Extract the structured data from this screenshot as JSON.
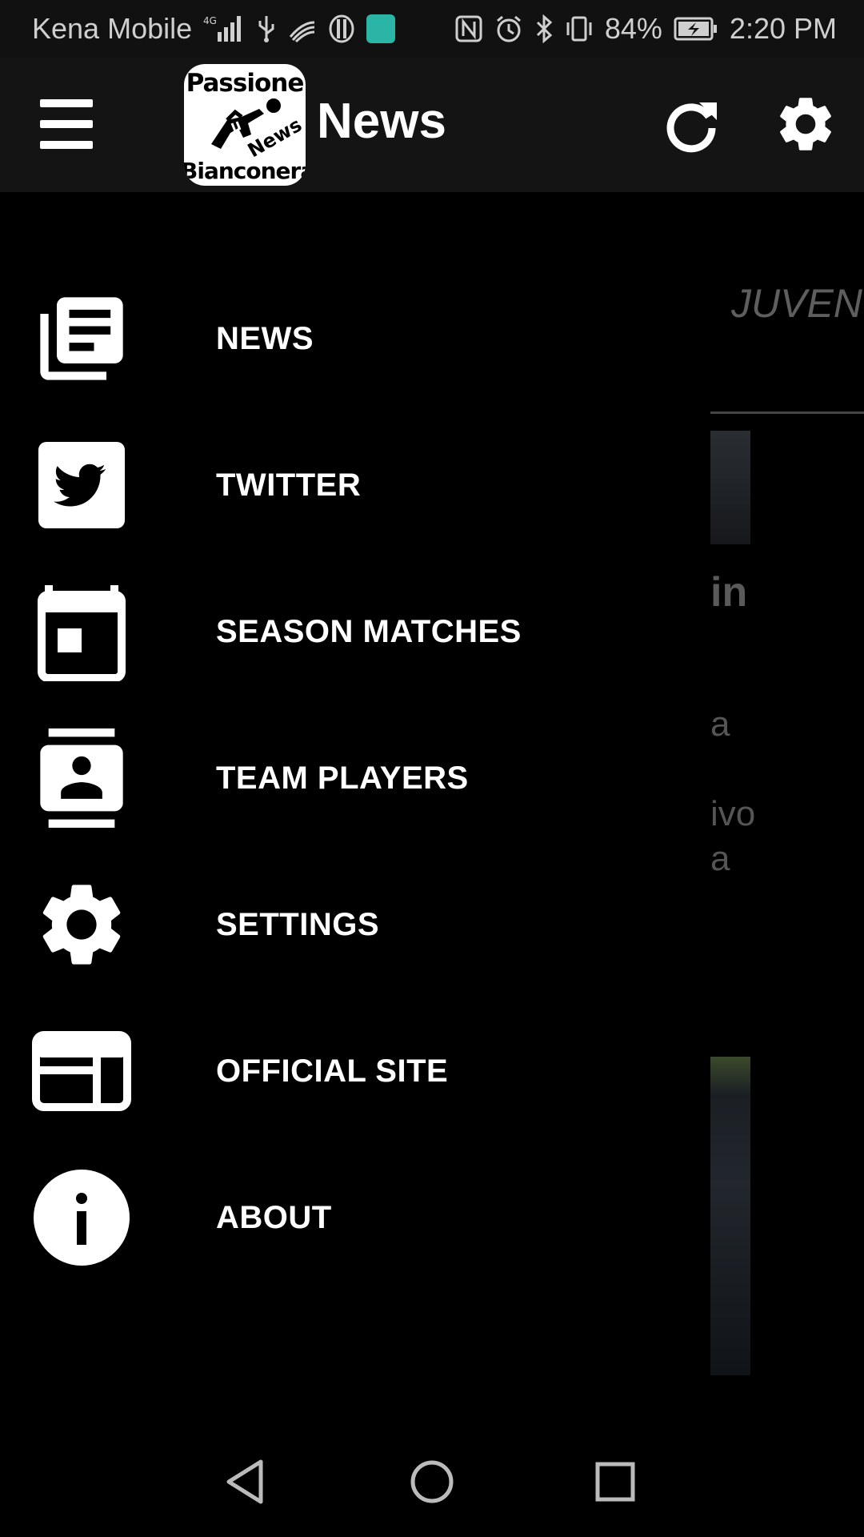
{
  "status_bar": {
    "carrier": "Kena Mobile",
    "network": "4G",
    "battery": "84%",
    "time": "2:20 PM"
  },
  "app_bar": {
    "logo_line1": "Passione",
    "logo_line2": "Bianconera",
    "logo_line3": "News",
    "title": "News"
  },
  "background": {
    "tab_label": "JUVEN",
    "text1": "in",
    "text2": "a",
    "text3": "ivo",
    "text4": "a"
  },
  "drawer": {
    "items": [
      {
        "label": "NEWS",
        "icon": "newspaper-icon"
      },
      {
        "label": "TWITTER",
        "icon": "twitter-icon"
      },
      {
        "label": "SEASON MATCHES",
        "icon": "calendar-icon"
      },
      {
        "label": "TEAM PLAYERS",
        "icon": "contacts-icon"
      },
      {
        "label": "SETTINGS",
        "icon": "gear-icon"
      },
      {
        "label": "OFFICIAL SITE",
        "icon": "web-icon"
      },
      {
        "label": "ABOUT",
        "icon": "info-icon"
      }
    ]
  },
  "colors": {
    "background": "#000000",
    "app_bar": "#141414",
    "status_bar": "#111111",
    "text": "#ffffff"
  }
}
